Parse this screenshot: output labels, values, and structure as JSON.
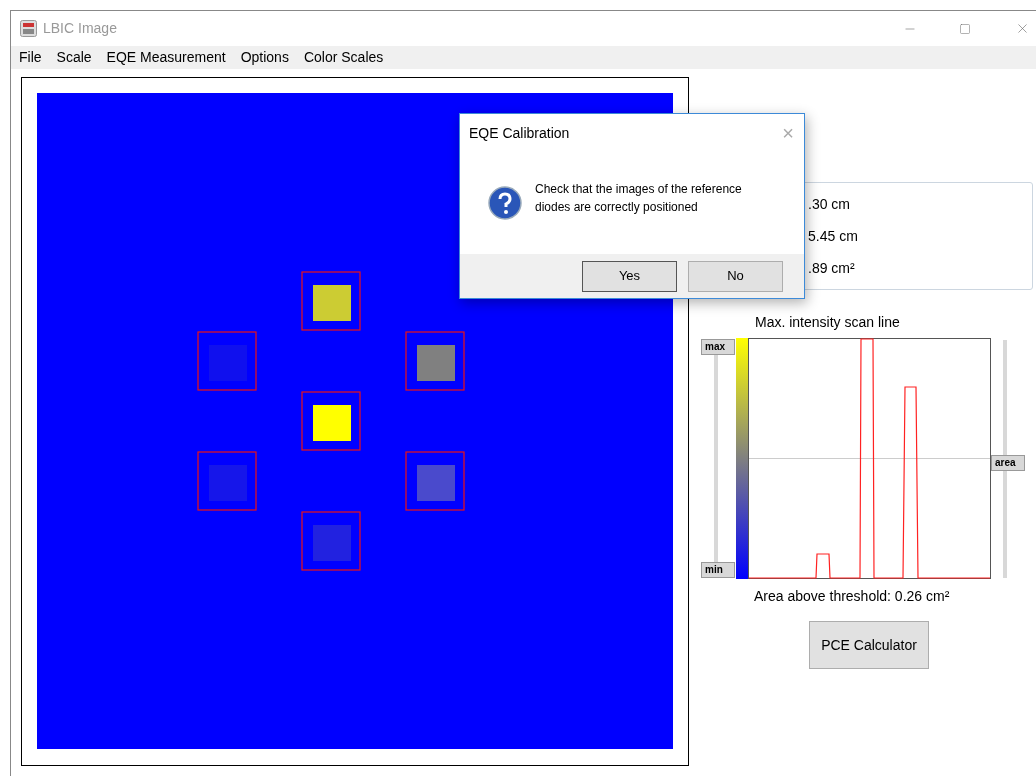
{
  "window": {
    "title": "LBIC Image"
  },
  "menu": [
    "File",
    "Scale",
    "EQE Measurement",
    "Options",
    "Color Scales"
  ],
  "info": [
    ".30 cm",
    "5.45 cm",
    ".89 cm²"
  ],
  "scan": {
    "title": "Max. intensity scan line",
    "handles": [
      {
        "kind": "threshold",
        "label": "max",
        "level": 1
      },
      {
        "kind": "threshold",
        "label": "min",
        "level": 0
      },
      {
        "kind": "area",
        "label": "area",
        "level": 0.5
      }
    ],
    "result": "Area above threshold: 0.26 cm²"
  },
  "pce_button": "PCE Calculator",
  "dialog": {
    "title": "EQE Calibration",
    "close": "×",
    "message": "Check that the images of the reference diodes are correctly positioned",
    "buttons": [
      "Yes",
      "No"
    ]
  }
}
